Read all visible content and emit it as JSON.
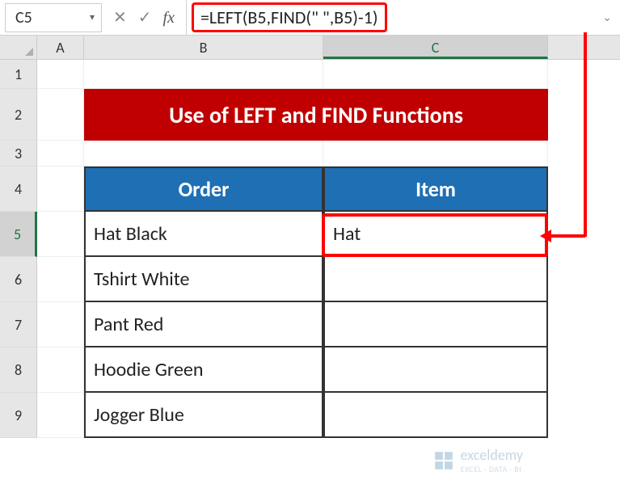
{
  "nameBox": {
    "value": "C5"
  },
  "formulaBar": {
    "buttons": {
      "cancel": "✕",
      "enter": "✓",
      "fx": "fx"
    },
    "formula": "=LEFT(B5,FIND(\" \",B5)-1)"
  },
  "columns": [
    "A",
    "B",
    "C"
  ],
  "title": "Use of LEFT and FIND Functions",
  "headers": {
    "order": "Order",
    "item": "Item"
  },
  "rows": [
    {
      "order": "Hat Black",
      "item": "Hat"
    },
    {
      "order": "Tshirt White",
      "item": ""
    },
    {
      "order": "Pant Red",
      "item": ""
    },
    {
      "order": "Hoodie Green",
      "item": ""
    },
    {
      "order": "Jogger Blue",
      "item": ""
    }
  ],
  "rowNumbers": [
    "1",
    "2",
    "3",
    "4",
    "5",
    "6",
    "7",
    "8",
    "9"
  ],
  "watermark": {
    "name": "exceldemy",
    "tagline": "EXCEL · DATA · BI"
  },
  "colors": {
    "titleBg": "#c00000",
    "headerBg": "#1f6fb5",
    "annotate": "#ff0000",
    "excelGreen": "#217346"
  }
}
